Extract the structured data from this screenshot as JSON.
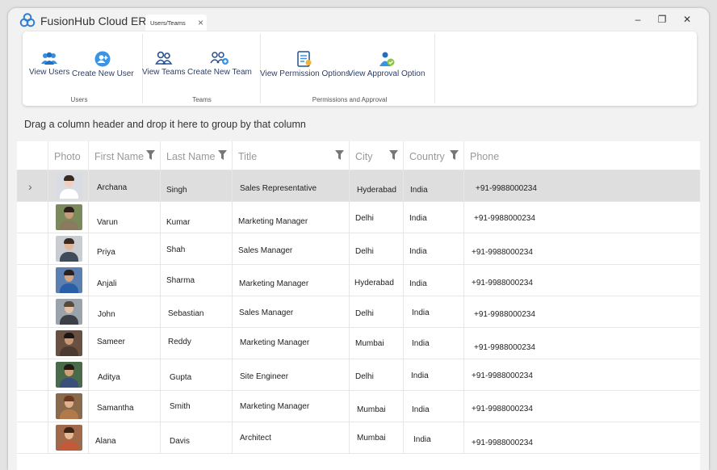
{
  "app": {
    "title": "FusionHub Cloud ERP"
  },
  "tab": {
    "label": "Users/Teams"
  },
  "window_controls": {
    "minimize": "–",
    "restore": "❐",
    "close": "✕"
  },
  "ribbon": {
    "groups": [
      {
        "label": "Users",
        "buttons": [
          {
            "label": "View Users",
            "icon": "users-icon"
          },
          {
            "label": "Create New User",
            "icon": "add-user-icon"
          }
        ]
      },
      {
        "label": "Teams",
        "buttons": [
          {
            "label": "View Teams",
            "icon": "teams-icon"
          },
          {
            "label": "Create New Team",
            "icon": "add-team-icon"
          }
        ]
      },
      {
        "label": "Permissions and Approval",
        "buttons": [
          {
            "label": "View Permission Options",
            "icon": "permission-icon"
          },
          {
            "label": "View Approval Option",
            "icon": "approval-icon"
          }
        ]
      }
    ]
  },
  "grid": {
    "group_hint": "Drag a column header and drop it here to group by that column",
    "columns": [
      "Photo",
      "First Name",
      "Last Name",
      "Title",
      "City",
      "Country",
      "Phone"
    ],
    "rows": [
      {
        "first": "Archana",
        "last": "Singh",
        "title": "Sales Representative",
        "city": "Hyderabad",
        "country": "India",
        "phone": "+91-9988000234"
      },
      {
        "first": "Varun",
        "last": "Kumar",
        "title": "Marketing Manager",
        "city": "Delhi",
        "country": "India",
        "phone": "+91-9988000234"
      },
      {
        "first": "Priya",
        "last": "Shah",
        "title": "Sales Manager",
        "city": "Delhi",
        "country": "India",
        "phone": "+91-9988000234"
      },
      {
        "first": "Anjali",
        "last": "Sharma",
        "title": "Marketing Manager",
        "city": "Hyderabad",
        "country": "India",
        "phone": "+91-9988000234"
      },
      {
        "first": "John",
        "last": "Sebastian",
        "title": "Sales Manager",
        "city": "Delhi",
        "country": "India",
        "phone": "+91-9988000234"
      },
      {
        "first": "Sameer",
        "last": "Reddy",
        "title": "Marketing Manager",
        "city": "Mumbai",
        "country": "India",
        "phone": "+91-9988000234"
      },
      {
        "first": "Aditya",
        "last": "Gupta",
        "title": "Site Engineer",
        "city": "Delhi",
        "country": "India",
        "phone": "+91-9988000234"
      },
      {
        "first": "Samantha",
        "last": "Smith",
        "title": "Marketing Manager",
        "city": "Mumbai",
        "country": "India",
        "phone": "+91-9988000234"
      },
      {
        "first": "Alana",
        "last": "Davis",
        "title": "Architect",
        "city": "Mumbai",
        "country": "India",
        "phone": "+91-9988000234"
      }
    ]
  },
  "colors": {
    "accent": "#2f8fe0",
    "ribbon_text": "#2b3f6a",
    "selected_row": "#dedede"
  }
}
